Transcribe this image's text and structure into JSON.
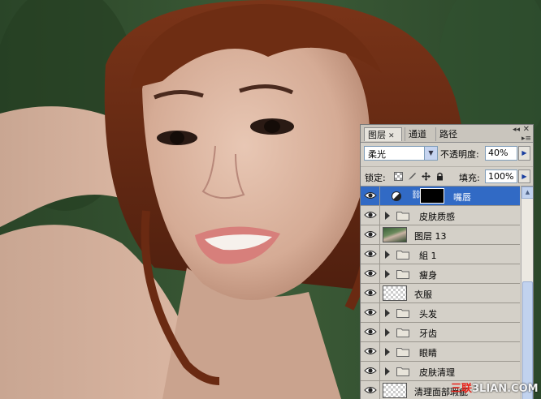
{
  "panel": {
    "tabs": [
      {
        "label": "图层",
        "active": true
      },
      {
        "label": "通道"
      },
      {
        "label": "路径"
      }
    ],
    "blend_mode": "柔光",
    "opacity_label": "不透明度:",
    "opacity_value": "40%",
    "lock_label": "锁定:",
    "fill_label": "填充:",
    "fill_value": "100%"
  },
  "layers": [
    {
      "name": "嘴唇",
      "type": "adjustment",
      "selected": true
    },
    {
      "name": "皮肤质感",
      "type": "group"
    },
    {
      "name": "图层 13",
      "type": "image"
    },
    {
      "name": "組 1",
      "type": "group"
    },
    {
      "name": "瘦身",
      "type": "group"
    },
    {
      "name": "衣服",
      "type": "empty"
    },
    {
      "name": "头发",
      "type": "group"
    },
    {
      "name": "牙齿",
      "type": "group"
    },
    {
      "name": "眼睛",
      "type": "group"
    },
    {
      "name": "皮肤清理",
      "type": "group"
    },
    {
      "name": "清理面部瑕疵",
      "type": "empty"
    }
  ],
  "watermark": {
    "prefix": "三联",
    "suffix": "3LIAN.COM"
  },
  "colors": {
    "selection": "#316ac5",
    "panel_bg": "#d4d0c8",
    "background_foliage": "#2f4a2e"
  }
}
